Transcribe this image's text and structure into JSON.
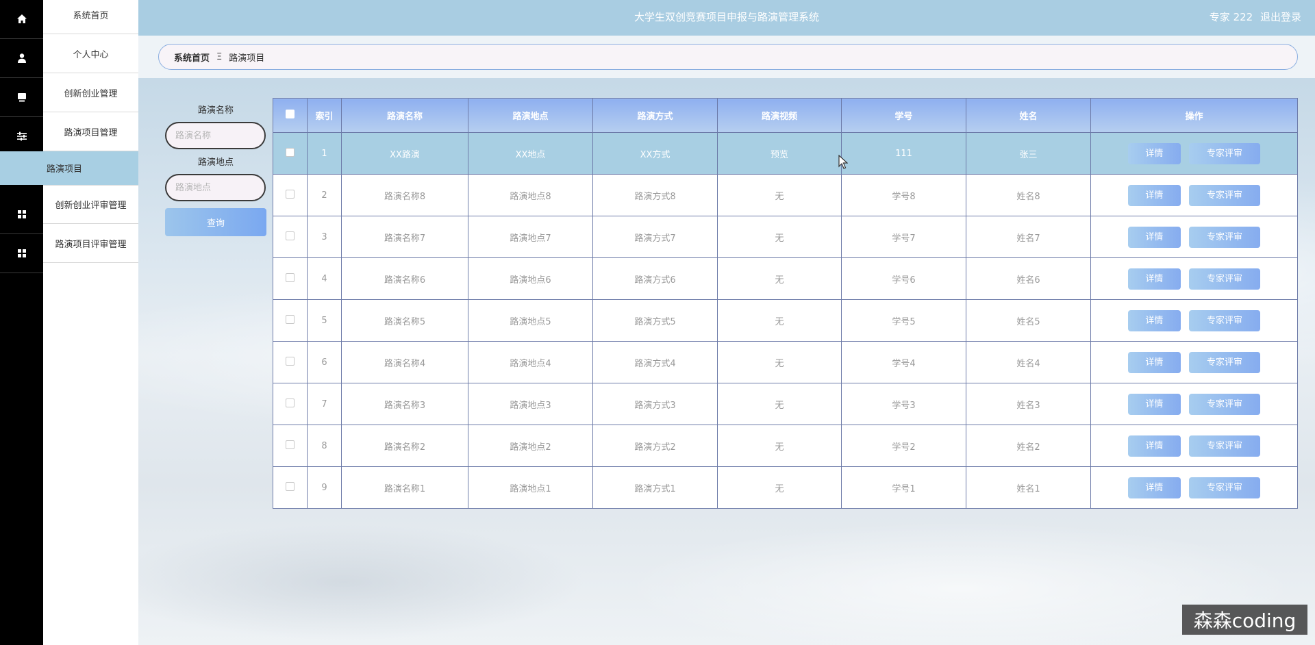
{
  "header": {
    "title": "大学生双创竞赛项目申报与路演管理系统",
    "user": "专家 222",
    "logout": "退出登录"
  },
  "sidebar": {
    "items": [
      {
        "label": "系统首页",
        "icon": "home-icon"
      },
      {
        "label": "个人中心",
        "icon": "user-icon"
      },
      {
        "label": "创新创业管理",
        "icon": "monitor-icon"
      },
      {
        "label": "路演项目管理",
        "icon": "sliders-icon"
      },
      {
        "label": "创新创业评审管理",
        "icon": "grid-icon"
      },
      {
        "label": "路演项目评审管理",
        "icon": "grid-icon"
      }
    ],
    "active_sub": "路演项目"
  },
  "breadcrumb": {
    "home": "系统首页",
    "separator": "Ξ",
    "current": "路演项目"
  },
  "search": {
    "name_label": "路演名称",
    "name_placeholder": "路演名称",
    "location_label": "路演地点",
    "location_placeholder": "路演地点",
    "query_button": "查询"
  },
  "table": {
    "headers": [
      "索引",
      "路演名称",
      "路演地点",
      "路演方式",
      "路演视频",
      "学号",
      "姓名",
      "操作"
    ],
    "detail_label": "详情",
    "review_label": "专家评审",
    "rows": [
      {
        "index": "1",
        "name": "XX路演",
        "location": "XX地点",
        "mode": "XX方式",
        "video": "预览",
        "student_no": "111",
        "student_name": "张三"
      },
      {
        "index": "2",
        "name": "路演名称8",
        "location": "路演地点8",
        "mode": "路演方式8",
        "video": "无",
        "student_no": "学号8",
        "student_name": "姓名8"
      },
      {
        "index": "3",
        "name": "路演名称7",
        "location": "路演地点7",
        "mode": "路演方式7",
        "video": "无",
        "student_no": "学号7",
        "student_name": "姓名7"
      },
      {
        "index": "4",
        "name": "路演名称6",
        "location": "路演地点6",
        "mode": "路演方式6",
        "video": "无",
        "student_no": "学号6",
        "student_name": "姓名6"
      },
      {
        "index": "5",
        "name": "路演名称5",
        "location": "路演地点5",
        "mode": "路演方式5",
        "video": "无",
        "student_no": "学号5",
        "student_name": "姓名5"
      },
      {
        "index": "6",
        "name": "路演名称4",
        "location": "路演地点4",
        "mode": "路演方式4",
        "video": "无",
        "student_no": "学号4",
        "student_name": "姓名4"
      },
      {
        "index": "7",
        "name": "路演名称3",
        "location": "路演地点3",
        "mode": "路演方式3",
        "video": "无",
        "student_no": "学号3",
        "student_name": "姓名3"
      },
      {
        "index": "8",
        "name": "路演名称2",
        "location": "路演地点2",
        "mode": "路演方式2",
        "video": "无",
        "student_no": "学号2",
        "student_name": "姓名2"
      },
      {
        "index": "9",
        "name": "路演名称1",
        "location": "路演地点1",
        "mode": "路演方式1",
        "video": "无",
        "student_no": "学号1",
        "student_name": "姓名1"
      }
    ]
  },
  "watermark": "森森coding",
  "colors": {
    "header_bg": "#a9cde2",
    "active_row": "#a8cfe3",
    "button_gradient_start": "#a7cdef",
    "button_gradient_end": "#86acef",
    "preview_link": "#2bb090"
  }
}
